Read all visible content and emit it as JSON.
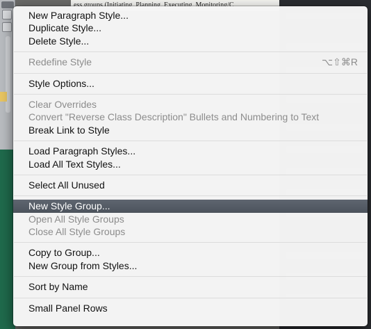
{
  "background": {
    "document_snippet": "ess groups (Initiating, Planning, Executing, Monitoring/C"
  },
  "menu": {
    "groups": [
      [
        {
          "label": "New Paragraph Style...",
          "enabled": true
        },
        {
          "label": "Duplicate Style...",
          "enabled": true
        },
        {
          "label": "Delete Style...",
          "enabled": true
        }
      ],
      [
        {
          "label": "Redefine Style",
          "enabled": false,
          "shortcut": "⌥⇧⌘R"
        }
      ],
      [
        {
          "label": "Style Options...",
          "enabled": true
        }
      ],
      [
        {
          "label": "Clear Overrides",
          "enabled": false
        },
        {
          "label": "Convert \"Reverse Class Description\" Bullets and Numbering to Text",
          "enabled": false
        },
        {
          "label": "Break Link to Style",
          "enabled": true
        }
      ],
      [
        {
          "label": "Load Paragraph Styles...",
          "enabled": true
        },
        {
          "label": "Load All Text Styles...",
          "enabled": true
        }
      ],
      [
        {
          "label": "Select All Unused",
          "enabled": true
        }
      ],
      [
        {
          "label": "New Style Group...",
          "enabled": true,
          "highlighted": true
        },
        {
          "label": "Open All Style Groups",
          "enabled": false
        },
        {
          "label": "Close All Style Groups",
          "enabled": false
        }
      ],
      [
        {
          "label": "Copy to Group...",
          "enabled": true
        },
        {
          "label": "New Group from Styles...",
          "enabled": true
        }
      ],
      [
        {
          "label": "Sort by Name",
          "enabled": true
        }
      ],
      [
        {
          "label": "Small Panel Rows",
          "enabled": true
        }
      ]
    ]
  }
}
